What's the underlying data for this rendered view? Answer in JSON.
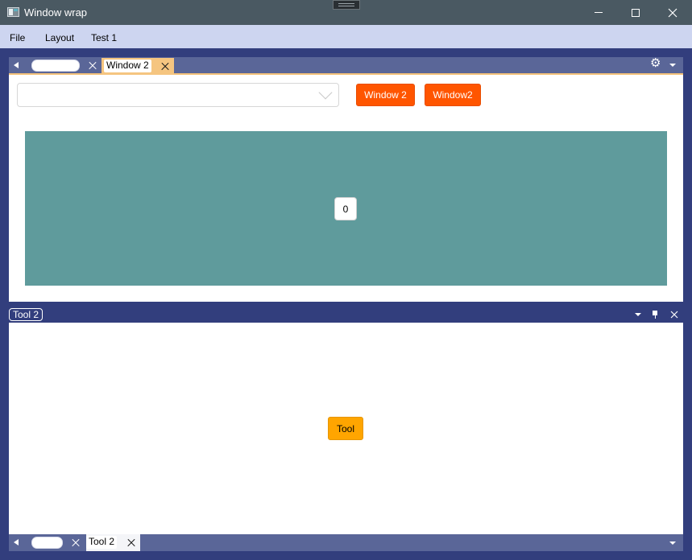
{
  "window": {
    "title": "Window wrap",
    "controls": [
      "minimize",
      "maximize",
      "close"
    ]
  },
  "menu": {
    "items": [
      "File",
      "Layout",
      "Test 1"
    ]
  },
  "document_tabs": {
    "tabs": [
      {
        "label": "",
        "active": false
      },
      {
        "label": "Window 2",
        "active": true
      }
    ],
    "icons": [
      "scroll-left-icon",
      "settings-gear-icon",
      "overflow-dropdown-icon"
    ]
  },
  "document": {
    "combo_value": "",
    "buttons": [
      "Window 2",
      "Window2"
    ],
    "counter_value": "0",
    "colors": {
      "panel": "#5f9b9c",
      "button": "#ff5500",
      "active_tab": "#f5c580"
    }
  },
  "tool_pane": {
    "title": "Tool 2",
    "button_label": "Tool",
    "button_color": "#ffa500",
    "icons": [
      "options-dropdown-icon",
      "pin-icon",
      "close-icon"
    ]
  },
  "tool_tabs": {
    "tabs": [
      {
        "label": "",
        "active": false
      },
      {
        "label": "Tool 2",
        "active": true
      }
    ]
  }
}
